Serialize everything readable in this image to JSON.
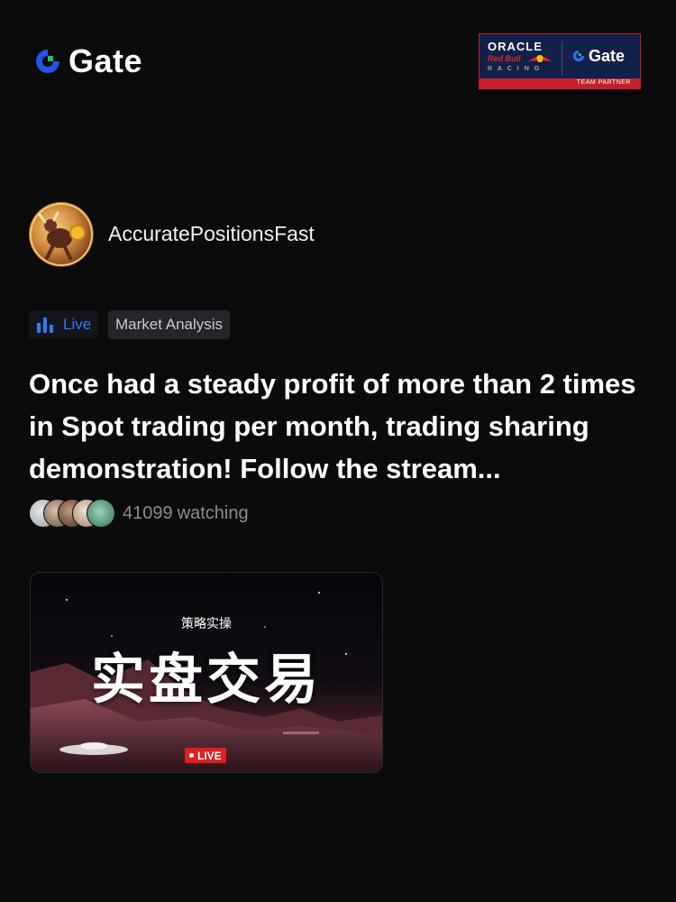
{
  "brand": {
    "name": "Gate",
    "logo_icon": "gate-logo-icon"
  },
  "partner_badge": {
    "line1": "ORACLE",
    "line2": "Red Bull",
    "line3": "RACING",
    "brand": "Gate",
    "footer": "TEAM PARTNER",
    "colors": {
      "background": "#13214a",
      "accent": "#c3202b"
    }
  },
  "streamer": {
    "name": "AccuratePositionsFast",
    "avatar_icon": "bull-avatar"
  },
  "tags": {
    "live_label": "Live",
    "live_icon": "bar-chart-icon",
    "category": "Market Analysis"
  },
  "stream": {
    "title": "Once had a steady profit of more than 2 times in Spot trading per month, trading sharing demonstration! Follow the stream...",
    "watching_count": "41099",
    "watching_label": "watching"
  },
  "thumbnail": {
    "subtitle": "策略实操",
    "headline": "实盘交易",
    "badge": "LIVE"
  },
  "colors": {
    "accent_blue": "#2f7cf6",
    "live_red": "#e02020",
    "background": "#0b0b0c"
  }
}
